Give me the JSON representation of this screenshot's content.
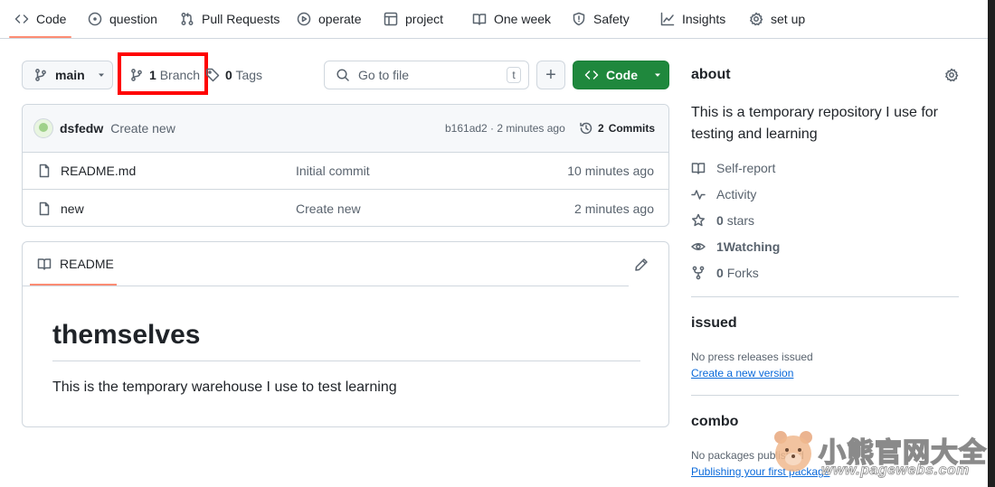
{
  "nav": {
    "tabs": [
      {
        "label": "Code",
        "icon": "code-icon"
      },
      {
        "label": "question",
        "icon": "issue-icon"
      },
      {
        "label": "Pull Requests",
        "icon": "pull-request-icon"
      },
      {
        "label": "operate",
        "icon": "play-icon"
      },
      {
        "label": "project",
        "icon": "table-icon"
      },
      {
        "label": "One week",
        "icon": "book-icon"
      },
      {
        "label": "Safety",
        "icon": "shield-icon"
      },
      {
        "label": "Insights",
        "icon": "graph-icon"
      },
      {
        "label": "set up",
        "icon": "gear-icon"
      }
    ]
  },
  "toolbar": {
    "branch_selector": "main",
    "branches_count": "1",
    "branches_label": "Branch",
    "tags_count": "0",
    "tags_label": "Tags",
    "goto_placeholder": "Go to file",
    "goto_shortcut": "t",
    "add_label": "+",
    "code_label": "Code"
  },
  "latest_commit": {
    "author": "dsfedw",
    "message": "Create new",
    "meta": "b161ad2 · 2 minutes ago",
    "commits_count": "2",
    "commits_label": "Commits"
  },
  "files": [
    {
      "name": "README.md",
      "commit": "Initial commit",
      "age": "10 minutes ago"
    },
    {
      "name": "new",
      "commit": "Create new",
      "age": "2 minutes ago"
    }
  ],
  "readme": {
    "tab_label": "README",
    "heading": "themselves",
    "body": "This is the temporary warehouse I use to test learning"
  },
  "about": {
    "title": "about",
    "description": "This is a temporary repository I use for testing and learning",
    "items": [
      {
        "icon": "book-icon",
        "count": "",
        "label": "Self-report"
      },
      {
        "icon": "pulse-icon",
        "count": "",
        "label": "Activity"
      },
      {
        "icon": "star-icon",
        "count": "0",
        "label": "stars"
      },
      {
        "icon": "eye-icon",
        "count": "1",
        "label": "Watching"
      },
      {
        "icon": "fork-icon",
        "count": "0",
        "label": "Forks"
      }
    ]
  },
  "releases": {
    "title": "issued",
    "empty_text": "No press releases issued",
    "link": "Create a new version"
  },
  "packages": {
    "title": "combo",
    "empty_text": "No packages published",
    "link": "Publishing your first package"
  },
  "watermark": {
    "title": "小熊官网大全",
    "url": "www.pagewebs.com"
  },
  "colors": {
    "accent_underline": "#fd8c73",
    "primary_button": "#1f883d",
    "highlight_box": "#ff0000",
    "link": "#0969da"
  }
}
